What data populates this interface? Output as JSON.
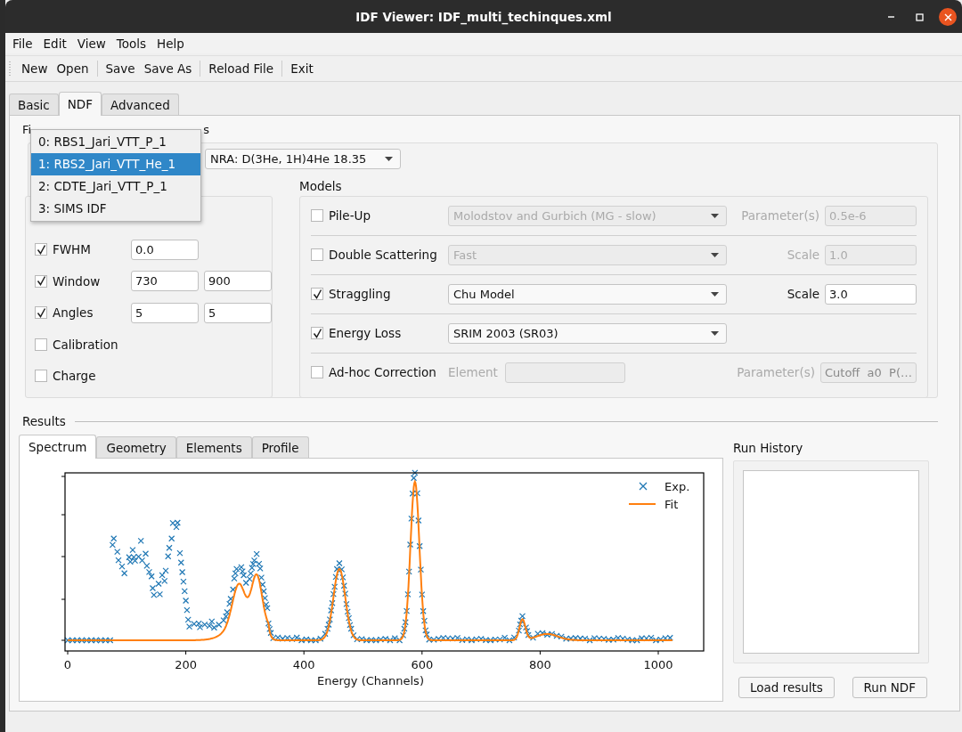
{
  "window": {
    "title": "IDF Viewer: IDF_multi_techinques.xml"
  },
  "menu": [
    "File",
    "Edit",
    "View",
    "Tools",
    "Help"
  ],
  "toolbar_groups": [
    [
      "New",
      "Open"
    ],
    [
      "Save",
      "Save As"
    ],
    [
      "Reload File"
    ],
    [
      "Exit"
    ]
  ],
  "tabs": [
    {
      "label": "Basic",
      "selected": false
    },
    {
      "label": "NDF",
      "selected": true
    },
    {
      "label": "Advanced",
      "selected": false
    }
  ],
  "fitting": {
    "title_parts": [
      "Fi",
      "s"
    ],
    "reaction_combo": "NRA: D(3He, 1H)4He 18.35",
    "parameters": [
      {
        "label": "FWHM",
        "checked": true,
        "values": [
          "0.0"
        ]
      },
      {
        "label": "Window",
        "checked": true,
        "values": [
          "730",
          "900"
        ]
      },
      {
        "label": "Angles",
        "checked": true,
        "values": [
          "5",
          "5"
        ]
      },
      {
        "label": "Calibration",
        "checked": false
      },
      {
        "label": "Charge",
        "checked": false
      }
    ],
    "models_title": "Models",
    "models": [
      {
        "kind": "combo",
        "label": "Pile-Up",
        "checked": false,
        "disabled": true,
        "combo": "Molodstov and Gurbich (MG - slow)",
        "param_label": "Parameter(s)",
        "param_value": "0.5e-6"
      },
      {
        "kind": "combo",
        "label": "Double Scattering",
        "checked": false,
        "disabled": true,
        "combo": "Fast",
        "param_label": "Scale",
        "param_value": "1.0"
      },
      {
        "kind": "combo",
        "label": "Straggling",
        "checked": true,
        "disabled": false,
        "combo": "Chu Model",
        "param_label": "Scale",
        "param_value": "3.0"
      },
      {
        "kind": "combo",
        "label": "Energy Loss",
        "checked": true,
        "disabled": false,
        "combo": "SRIM 2003 (SR03)"
      },
      {
        "kind": "element",
        "label": "Ad-hoc Correction",
        "checked": false,
        "disabled": true,
        "element_label": "Element",
        "param_label": "Parameter(s)",
        "param_value": "Cutoff  a0  P(…"
      }
    ]
  },
  "popup": {
    "items": [
      {
        "label": "0: RBS1_Jari_VTT_P_1",
        "selected": false
      },
      {
        "label": "1: RBS2_Jari_VTT_He_1",
        "selected": true
      },
      {
        "label": "2: CDTE_Jari_VTT_P_1",
        "selected": false
      },
      {
        "label": "3: SIMS IDF",
        "selected": false
      }
    ]
  },
  "results": {
    "title": "Results",
    "tabs": [
      {
        "label": "Spectrum",
        "selected": true
      },
      {
        "label": "Geometry",
        "selected": false
      },
      {
        "label": "Elements",
        "selected": false
      },
      {
        "label": "Profile",
        "selected": false
      }
    ],
    "plot": {
      "legend": [
        {
          "kind": "marker",
          "label": "Exp."
        },
        {
          "kind": "line",
          "label": "Fit"
        }
      ],
      "xticks": [
        "0",
        "200",
        "400",
        "600",
        "800",
        "1000"
      ],
      "xlabel": "Energy (Channels)"
    },
    "history_title": "Run History",
    "buttons": [
      "Load results",
      "Run NDF"
    ]
  }
}
